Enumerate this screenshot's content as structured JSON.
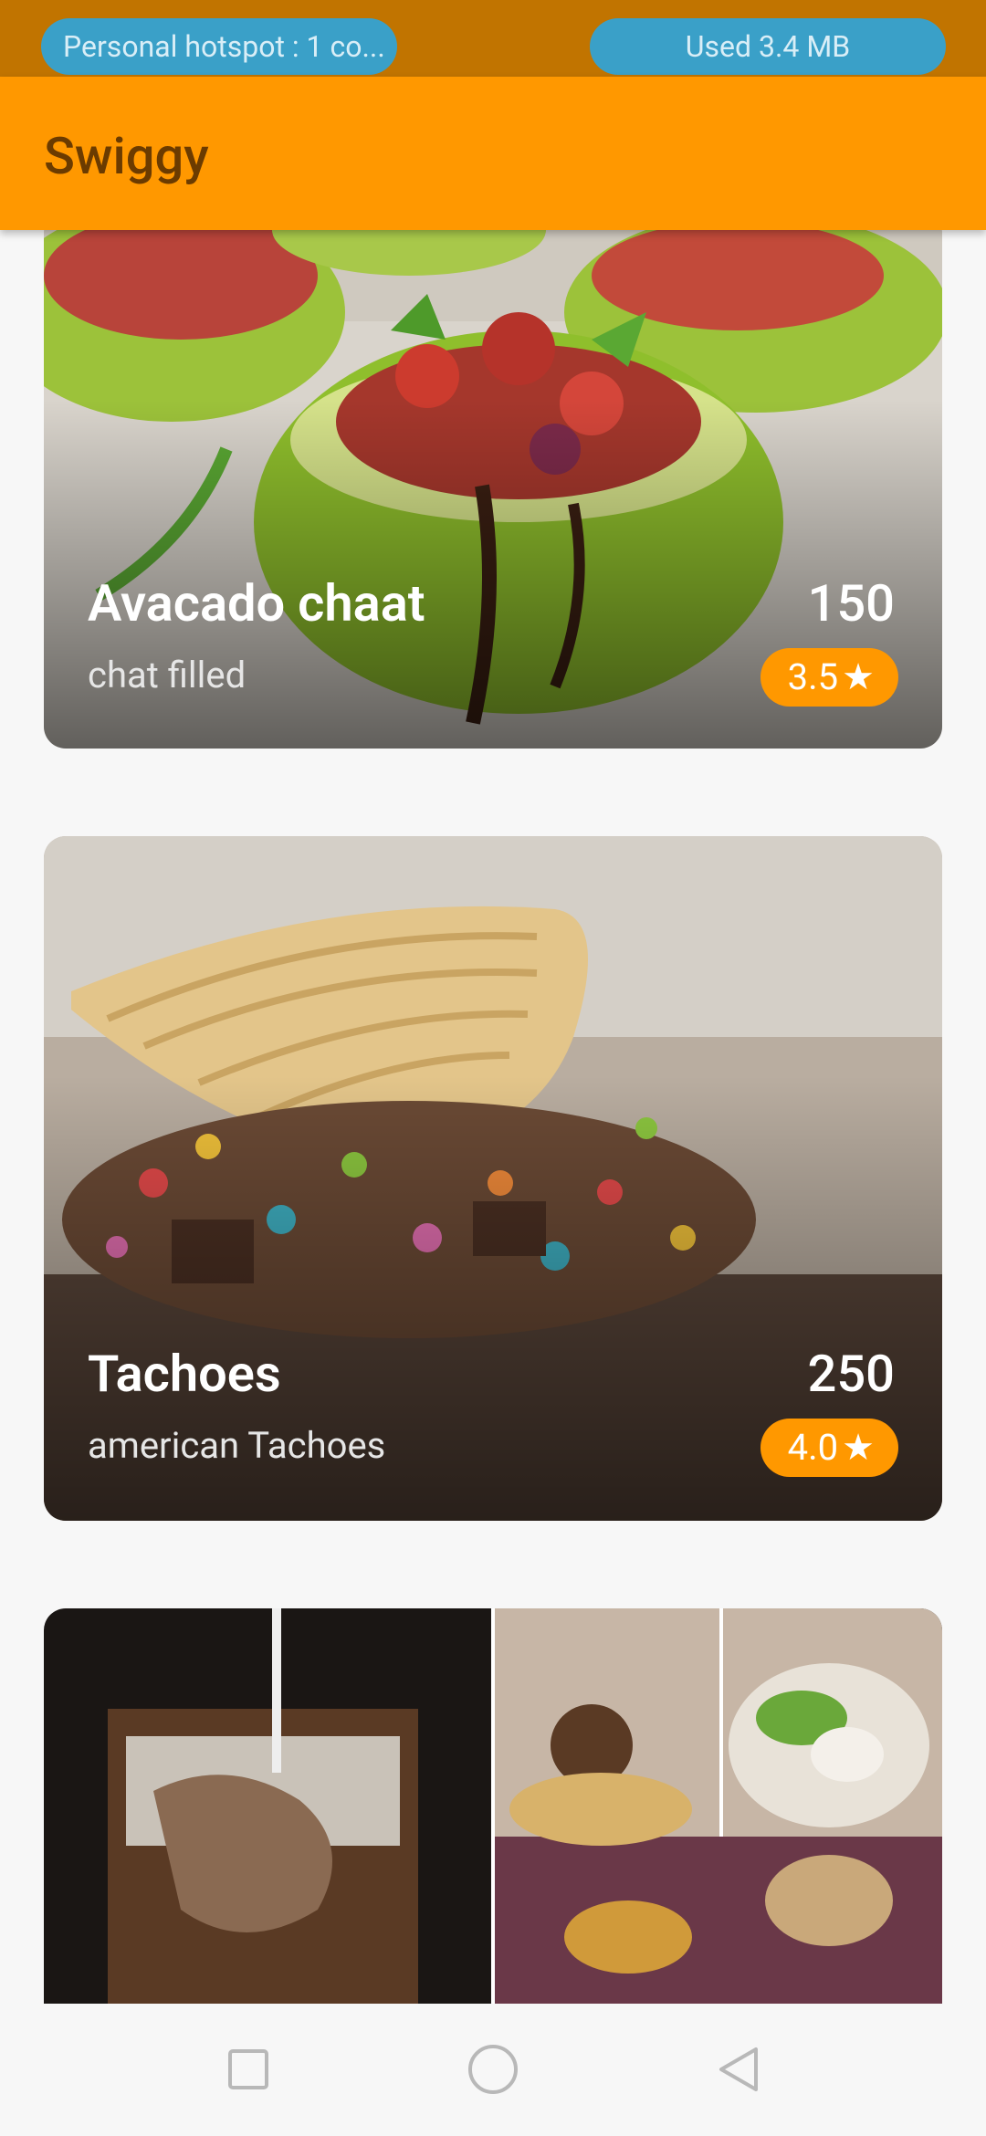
{
  "status_bar": {
    "hotspot": "Personal hotspot : 1 co...",
    "data_usage": "Used  3.4 MB"
  },
  "app_bar": {
    "title": "Swiggy"
  },
  "items": [
    {
      "name": "Avacado chaat",
      "price": "150",
      "description": "chat filled",
      "rating": "3.5",
      "rating_icon": "star-icon"
    },
    {
      "name": "Tachoes",
      "price": "250",
      "description": "american Tachoes",
      "rating": "4.0",
      "rating_icon": "star-icon"
    }
  ],
  "nav": {
    "icons": [
      "recents-square-icon",
      "home-circle-icon",
      "back-triangle-icon"
    ]
  },
  "colors": {
    "accent": "#ff9800",
    "status_bar": "#c17400",
    "pill": "#3aa0c8"
  }
}
